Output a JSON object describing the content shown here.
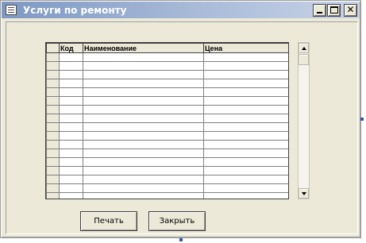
{
  "window": {
    "title": "Услуги по ремонту",
    "icon": "window-app-icon",
    "controls": {
      "minimize": "minimize-icon",
      "maximize": "maximize-icon",
      "close_label": "✕"
    }
  },
  "grid": {
    "columns": [
      "",
      "Код",
      "Наименование",
      "Цена"
    ],
    "rows": 17
  },
  "buttons": {
    "print_label": "Печать",
    "close_label": "Закрыть"
  },
  "colors": {
    "face": "#ece9d8",
    "title_start": "#7d98c3",
    "title_end": "#c8d3e6"
  }
}
